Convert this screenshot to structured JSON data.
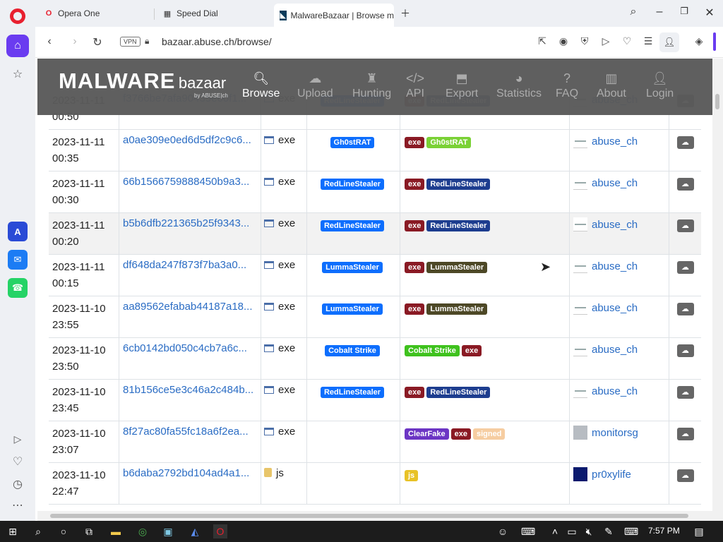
{
  "browser": {
    "tabs": [
      {
        "label": "Opera One"
      },
      {
        "label": "Speed Dial"
      },
      {
        "label": "MalwareBazaar | Browse m"
      }
    ],
    "vpn_label": "VPN",
    "url": "bazaar.abuse.ch/browse/"
  },
  "site": {
    "brand_main": "MALWARE",
    "brand_sub": "bazaar",
    "brand_by": "by ABUSE|ch",
    "nav": [
      {
        "label": "Browse",
        "icon": "search-icon"
      },
      {
        "label": "Upload",
        "icon": "cloud-upload-icon"
      },
      {
        "label": "Hunting",
        "icon": "hunting-icon"
      },
      {
        "label": "API",
        "icon": "code-icon"
      },
      {
        "label": "Export",
        "icon": "export-icon"
      },
      {
        "label": "Statistics",
        "icon": "pie-chart-icon"
      },
      {
        "label": "FAQ",
        "icon": "question-icon"
      },
      {
        "label": "About",
        "icon": "building-icon"
      },
      {
        "label": "Login",
        "icon": "user-icon"
      }
    ]
  },
  "rows": [
    {
      "date": "2023-11-11",
      "time": "00:50",
      "hash": "f3766be7afa90435e60f1...",
      "type": "exe",
      "signature": "RedLineStealer",
      "tags": [
        "exe",
        "RedLineStealer"
      ],
      "reporter": "abuse_ch"
    },
    {
      "date": "2023-11-11",
      "time": "00:35",
      "hash": "a0ae309e0ed6d5df2c9c6...",
      "type": "exe",
      "signature": "Gh0stRAT",
      "tags": [
        "exe",
        "Gh0stRAT"
      ],
      "reporter": "abuse_ch"
    },
    {
      "date": "2023-11-11",
      "time": "00:30",
      "hash": "66b1566759888450b9a3...",
      "type": "exe",
      "signature": "RedLineStealer",
      "tags": [
        "exe",
        "RedLineStealer"
      ],
      "reporter": "abuse_ch"
    },
    {
      "date": "2023-11-11",
      "time": "00:20",
      "hash": "b5b6dfb221365b25f9343...",
      "type": "exe",
      "signature": "RedLineStealer",
      "tags": [
        "exe",
        "RedLineStealer"
      ],
      "reporter": "abuse_ch"
    },
    {
      "date": "2023-11-11",
      "time": "00:15",
      "hash": "df648da247f873f7ba3a0...",
      "type": "exe",
      "signature": "LummaStealer",
      "tags": [
        "exe",
        "LummaStealer"
      ],
      "reporter": "abuse_ch"
    },
    {
      "date": "2023-11-10",
      "time": "23:55",
      "hash": "aa89562efabab44187a18...",
      "type": "exe",
      "signature": "LummaStealer",
      "tags": [
        "exe",
        "LummaStealer"
      ],
      "reporter": "abuse_ch"
    },
    {
      "date": "2023-11-10",
      "time": "23:50",
      "hash": "6cb0142bd050c4cb7a6c...",
      "type": "exe",
      "signature": "Cobalt Strike",
      "tags": [
        "Cobalt Strike",
        "exe"
      ],
      "reporter": "abuse_ch"
    },
    {
      "date": "2023-11-10",
      "time": "23:45",
      "hash": "81b156ce5e3c46a2c484b...",
      "type": "exe",
      "signature": "RedLineStealer",
      "tags": [
        "exe",
        "RedLineStealer"
      ],
      "reporter": "abuse_ch"
    },
    {
      "date": "2023-11-10",
      "time": "23:07",
      "hash": "8f27ac80fa55fc18a6f2ea...",
      "type": "exe",
      "signature": "",
      "tags": [
        "ClearFake",
        "exe",
        "signed"
      ],
      "reporter": "monitorsg"
    },
    {
      "date": "2023-11-10",
      "time": "22:47",
      "hash": "b6daba2792bd104ad4a1...",
      "type": "js",
      "signature": "",
      "tags": [
        "js"
      ],
      "reporter": "pr0xylife"
    }
  ],
  "colors": {
    "accent": "#6a3cf0",
    "navbar": "#5a5a5a",
    "link": "#2a6cc4"
  },
  "taskbar": {
    "time": "7:57 PM"
  }
}
